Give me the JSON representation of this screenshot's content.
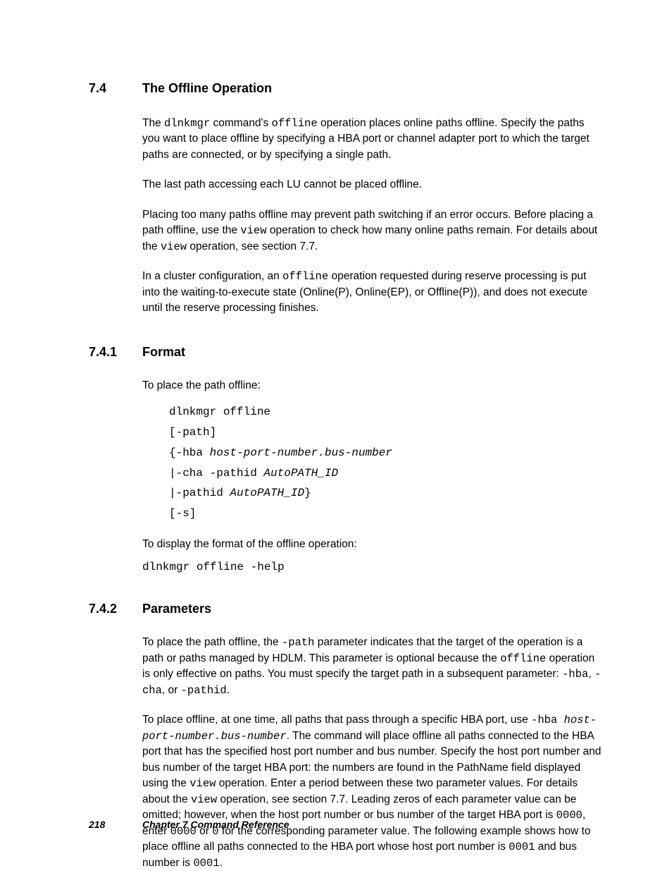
{
  "sec74": {
    "num": "7.4",
    "title": "The Offline Operation"
  },
  "p1a": "The ",
  "p1b": "dlnkmgr",
  "p1c": " command's ",
  "p1d": "offline",
  "p1e": " operation places online paths offline. Specify the paths you want to place offline by specifying a HBA port or channel adapter port to which the target paths are connected, or by specifying a single path.",
  "p2": "The last path accessing each LU cannot be placed offline.",
  "p3a": "Placing too many paths offline may prevent path switching if an error occurs. Before placing a path offline, use the ",
  "p3b": "view",
  "p3c": " operation to check how many online paths remain. For details about the ",
  "p3d": "view",
  "p3e": " operation, see section 7.7.",
  "p4a": "In a cluster configuration, an ",
  "p4b": "offline",
  "p4c": " operation requested during reserve processing is put into the waiting-to-execute state (Online(P), Online(EP), or Offline(P)), and does not execute until the reserve processing finishes.",
  "sec741": {
    "num": "7.4.1",
    "title": "Format"
  },
  "fmt_intro": "To place the path offline:",
  "code1": {
    "l1": "dlnkmgr offline",
    "l2": "[-path]",
    "l3a": "{-hba ",
    "l3b": "host-port-number.bus-number",
    "l4a": "|-cha -pathid ",
    "l4b": "AutoPATH_ID",
    "l5a": "|-pathid ",
    "l5b": "AutoPATH_ID",
    "l5c": "}",
    "l6": "[-s]"
  },
  "fmt_intro2": "To display the format of the offline operation:",
  "code2": "dlnkmgr offline -help",
  "sec742": {
    "num": "7.4.2",
    "title": "Parameters"
  },
  "pp1a": "To place the path offline, the ",
  "pp1b": "-path",
  "pp1c": " parameter indicates that the target of the operation is a path or paths managed by HDLM. This parameter is optional because the ",
  "pp1d": "offline",
  "pp1e": " operation is only effective on paths. You must specify the target path in a subsequent parameter: ",
  "pp1f": "-hba",
  "pp1g": ", ",
  "pp1h": "-cha",
  "pp1i": ", or ",
  "pp1j": "-pathid",
  "pp1k": ".",
  "pp2a": "To place offline, at one time, all paths that pass through a specific HBA port, use ",
  "pp2b": "-hba ",
  "pp2c": "host-port-number.bus-number",
  "pp2d": ". The command will place offline all paths connected to the HBA port that has the specified host port number and bus number. Specify the host port number and bus number of the target HBA port: the numbers are found in the PathName field displayed using the ",
  "pp2e": "view",
  "pp2f": " operation. Enter a period between these two parameter values. For details about the ",
  "pp2g": "view",
  "pp2h": " operation, see section 7.7. Leading zeros of each parameter value can be omitted; however, when the host port number or bus number of the target HBA port is ",
  "pp2i": "0000",
  "pp2j": ", enter ",
  "pp2k": "0000",
  "pp2l": " or ",
  "pp2m": "0",
  "pp2n": " for the corresponding parameter value. The following example shows how to place offline all paths connected to the HBA port whose host port number is ",
  "pp2o": "0001",
  "pp2p": " and bus number is ",
  "pp2q": "0001",
  "pp2r": ".",
  "footer": {
    "page": "218",
    "chapter": "Chapter 7   Command  Reference"
  }
}
